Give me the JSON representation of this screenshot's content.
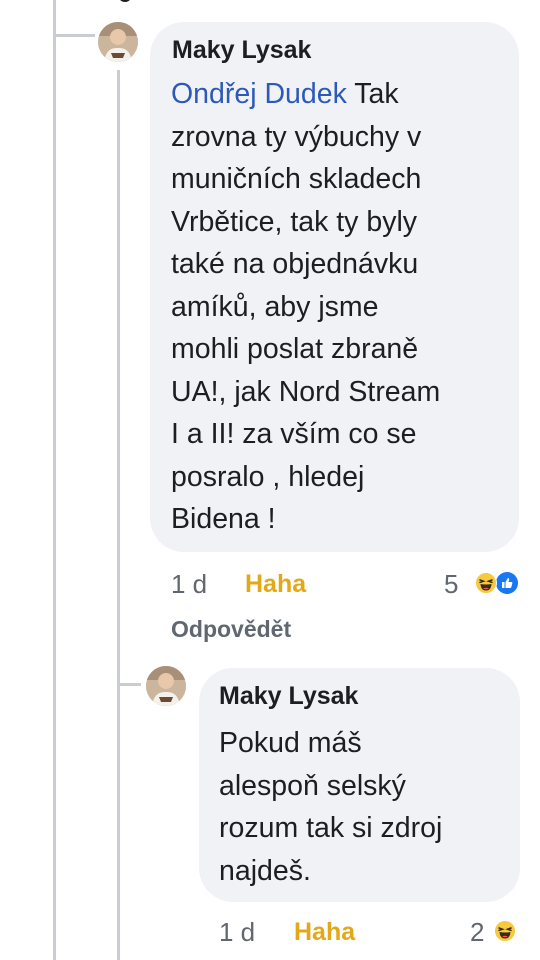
{
  "comment": {
    "author": "Maky Lysak",
    "mention": "Ondřej Dudek",
    "lines": [
      " Tak",
      "zrovna ty výbuchy v",
      "muničních skladech",
      "Vrbětice, tak ty byly",
      "také na objednávku",
      "amíků, aby jsme",
      "mohli poslat zbraně",
      "UA!, jak Nord Stream",
      "I a II! za vším co se",
      "posralo , hledej",
      "Bidena !"
    ],
    "time": "1 d",
    "reaction_link": "Haha",
    "reply_link": "Odpovědět",
    "reaction_count": "5",
    "reaction_icons": [
      "haha-icon",
      "like-icon"
    ]
  },
  "reply": {
    "author": "Maky Lysak",
    "lines": [
      "Pokud máš",
      "alespoň selský",
      "rozum tak si zdroj",
      "najdeš."
    ],
    "time": "1 d",
    "reaction_link": "Haha",
    "reaction_count": "2",
    "reaction_icons": [
      "haha-icon"
    ]
  },
  "colors": {
    "mention": "#2d59b8",
    "haha": "#e3a818",
    "like": "#1877f2",
    "bubble": "#f0f2f5"
  }
}
